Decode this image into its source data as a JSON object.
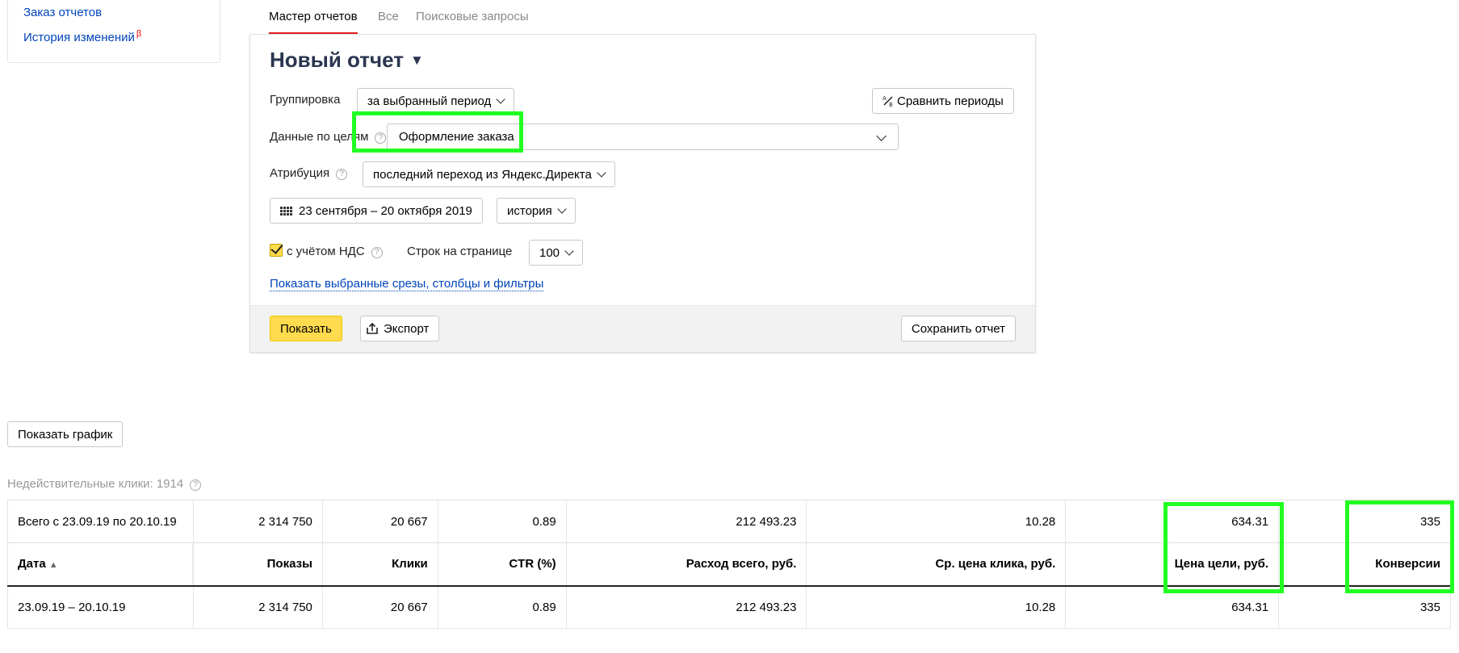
{
  "sidebar": {
    "links": [
      {
        "label": "Заказ отчетов"
      },
      {
        "label": "История изменений",
        "badge": "β"
      }
    ]
  },
  "tabs": [
    {
      "label": "Мастер отчетов",
      "active": true
    },
    {
      "label": "Все",
      "active": false
    },
    {
      "label": "Поисковые запросы",
      "active": false
    }
  ],
  "report": {
    "title": "Новый отчет",
    "title_caret": "▼",
    "grouping_label": "Группировка",
    "grouping_value": "за выбранный период",
    "compare_label": "Сравнить периоды",
    "goals_label": "Данные по целям",
    "goals_value": "Оформление заказа",
    "attribution_label": "Атрибуция",
    "attribution_value": "последний переход из Яндекс.Директа",
    "date_range": "23 сентября – 20 октября 2019",
    "history_label": "история",
    "vat_label": "с учётом НДС",
    "vat_checked": true,
    "rows_label": "Строк на странице",
    "rows_value": "100",
    "show_filters_link": "Показать выбранные срезы, столбцы и фильтры",
    "show_button": "Показать",
    "export_button": "Экспорт",
    "save_button": "Сохранить отчет"
  },
  "chart_button": "Показать график",
  "invalid_clicks": "Недействительные клики: 1914",
  "help_glyph": "?",
  "table": {
    "total_row": [
      "Всего с 23.09.19 по 20.10.19",
      "2 314 750",
      "20 667",
      "0.89",
      "212 493.23",
      "10.28",
      "634.31",
      "335"
    ],
    "headers": [
      "Дата",
      "Показы",
      "Клики",
      "CTR (%)",
      "Расход всего, руб.",
      "Ср. цена клика, руб.",
      "Цена цели, руб.",
      "Конверсии"
    ],
    "sort_indicator": "▲",
    "rows": [
      [
        "23.09.19 – 20.10.19",
        "2 314 750",
        "20 667",
        "0.89",
        "212 493.23",
        "10.28",
        "634.31",
        "335"
      ]
    ]
  },
  "colors": {
    "link": "#0044bb",
    "accent_yellow": "#ffdb4d",
    "highlight_green": "#22ff22",
    "tab_underline": "#e02020",
    "title": "#2a3550"
  }
}
